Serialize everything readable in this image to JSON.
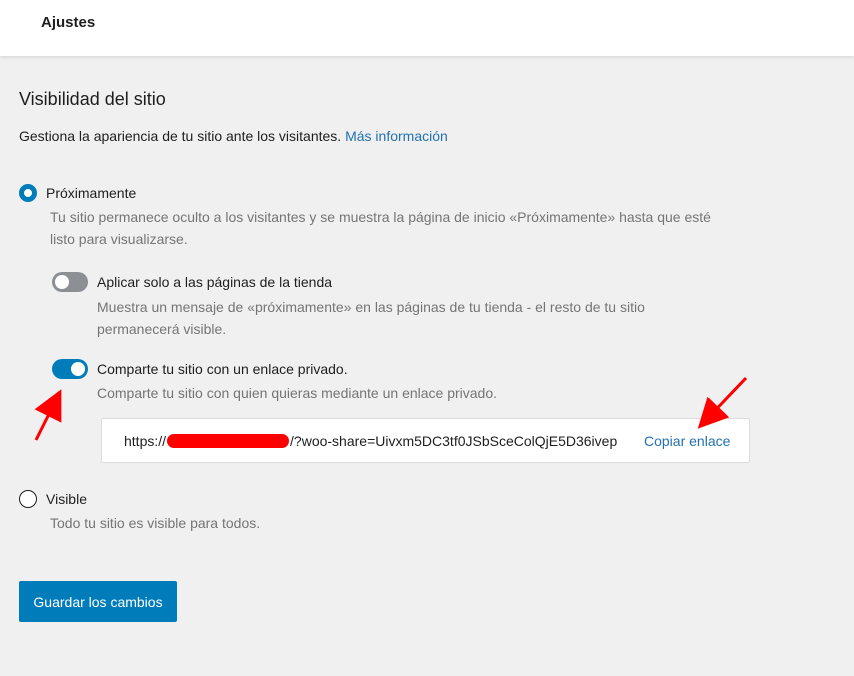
{
  "header": {
    "title": "Ajustes"
  },
  "visibility": {
    "title": "Visibilidad del sitio",
    "description": "Gestiona la apariencia de tu sitio ante los visitantes.",
    "more_info_link": "Más información"
  },
  "options": {
    "coming_soon": {
      "label": "Próximamente",
      "checked": true,
      "help_line1": "Tu sitio permanece oculto a los visitantes y se muestra la página de inicio «Próximamente» hasta que esté",
      "help_line2": "listo para visualizarse."
    },
    "store_only": {
      "label": "Aplicar solo a las páginas de la tienda",
      "enabled": false,
      "help_line1": "Muestra un mensaje de «próximamente» en las páginas de tu tienda - el resto de tu sitio",
      "help_line2": "permanecerá visible."
    },
    "private_link": {
      "label": "Comparte tu sitio con un enlace privado.",
      "enabled": true,
      "help": "Comparte tu sitio con quien quieras mediante un enlace privado."
    },
    "share_url": {
      "prefix": "https://",
      "suffix": "/?woo-share=Uivxm5DC3tf0JSbSceColQjE5D36ivep",
      "copy_label": "Copiar enlace"
    },
    "visible": {
      "label": "Visible",
      "checked": false,
      "help": "Todo tu sitio es visible para todos."
    }
  },
  "actions": {
    "save_label": "Guardar los cambios"
  },
  "colors": {
    "accent": "#007cba",
    "link": "#2271b1",
    "annotation": "#ff0000"
  }
}
